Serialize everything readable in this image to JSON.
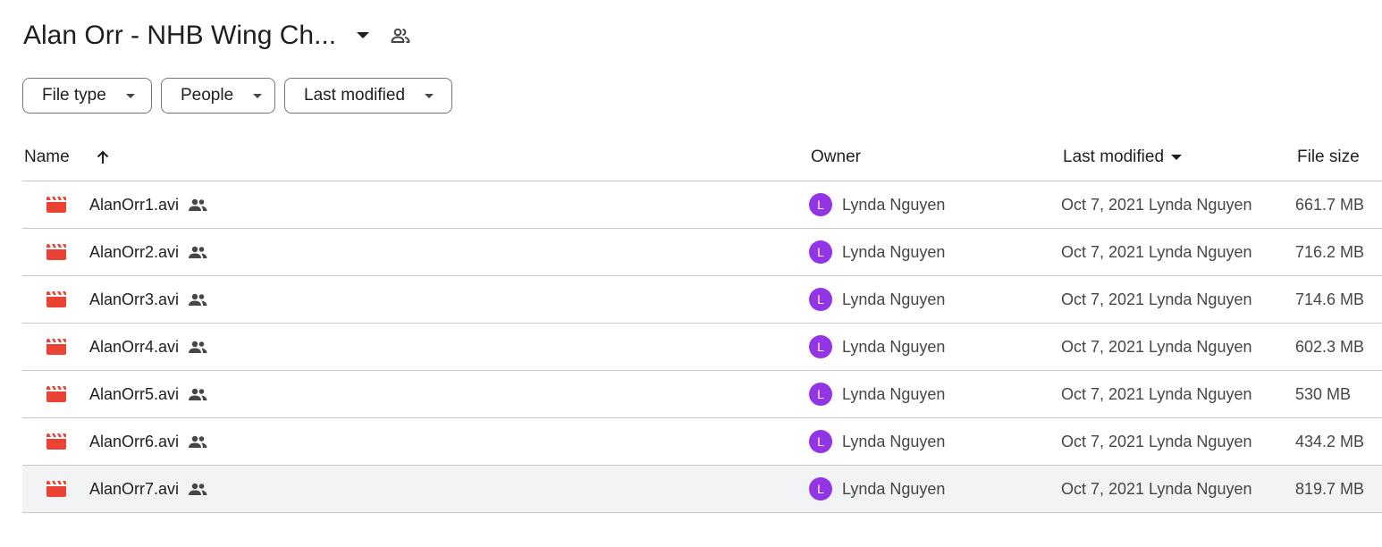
{
  "header": {
    "title": "Alan Orr - NHB Wing Ch...",
    "caret_icon": "dropdown-caret-icon",
    "share_icon": "people-outline-icon"
  },
  "filters": {
    "file_type": "File type",
    "people": "People",
    "last_modified": "Last modified"
  },
  "table": {
    "columns": {
      "name": "Name",
      "owner": "Owner",
      "last_modified": "Last modified",
      "file_size": "File size"
    },
    "sort": {
      "column": "Name",
      "direction": "ascending"
    },
    "rows": [
      {
        "name": "AlanOrr1.avi",
        "owner_initial": "L",
        "owner": "Lynda Nguyen",
        "modified": "Oct 7, 2021 Lynda Nguyen",
        "size": "661.7 MB"
      },
      {
        "name": "AlanOrr2.avi",
        "owner_initial": "L",
        "owner": "Lynda Nguyen",
        "modified": "Oct 7, 2021 Lynda Nguyen",
        "size": "716.2 MB"
      },
      {
        "name": "AlanOrr3.avi",
        "owner_initial": "L",
        "owner": "Lynda Nguyen",
        "modified": "Oct 7, 2021 Lynda Nguyen",
        "size": "714.6 MB"
      },
      {
        "name": "AlanOrr4.avi",
        "owner_initial": "L",
        "owner": "Lynda Nguyen",
        "modified": "Oct 7, 2021 Lynda Nguyen",
        "size": "602.3 MB"
      },
      {
        "name": "AlanOrr5.avi",
        "owner_initial": "L",
        "owner": "Lynda Nguyen",
        "modified": "Oct 7, 2021 Lynda Nguyen",
        "size": "530 MB"
      },
      {
        "name": "AlanOrr6.avi",
        "owner_initial": "L",
        "owner": "Lynda Nguyen",
        "modified": "Oct 7, 2021 Lynda Nguyen",
        "size": "434.2 MB"
      },
      {
        "name": "AlanOrr7.avi",
        "owner_initial": "L",
        "owner": "Lynda Nguyen",
        "modified": "Oct 7, 2021 Lynda Nguyen",
        "size": "819.7 MB"
      }
    ]
  },
  "colors": {
    "video_icon": "#ea4335",
    "avatar": "#9334e6",
    "selected_row": "#f1f3f4",
    "divider": "#c7c7c7"
  }
}
